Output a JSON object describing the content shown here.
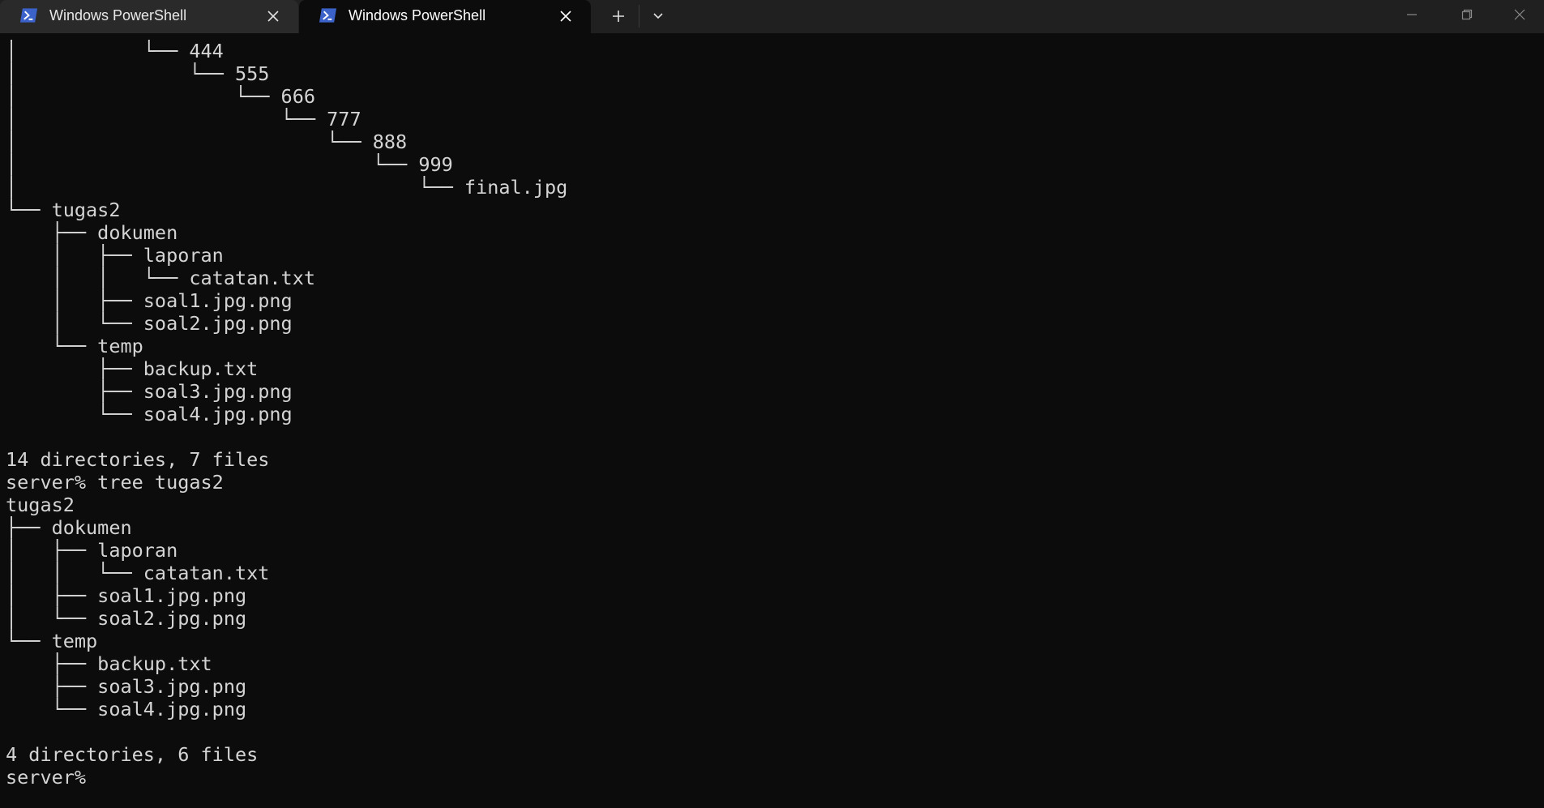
{
  "tabs": [
    {
      "label": "Windows PowerShell",
      "active": false
    },
    {
      "label": "Windows PowerShell",
      "active": true
    }
  ],
  "titlebar": {
    "new_tab_icon": "plus-icon",
    "dropdown_icon": "chevron-down-icon",
    "window_controls": [
      "minimize-icon",
      "maximize-icon",
      "close-icon"
    ]
  },
  "colors": {
    "terminal_bg": "#0c0c0c",
    "terminal_fg": "#d4d4d4",
    "titlebar_bg": "#202020",
    "powershell_icon": "#3a62c9"
  },
  "terminal": {
    "lines": [
      "│           └── 444",
      "│               └── 555",
      "│                   └── 666",
      "│                       └── 777",
      "│                           └── 888",
      "│                               └── 999",
      "│                                   └── final.jpg",
      "└── tugas2",
      "    ├── dokumen",
      "    │   ├── laporan",
      "    │   │   └── catatan.txt",
      "    │   ├── soal1.jpg.png",
      "    │   └── soal2.jpg.png",
      "    └── temp",
      "        ├── backup.txt",
      "        ├── soal3.jpg.png",
      "        └── soal4.jpg.png",
      "",
      "14 directories, 7 files",
      "server% tree tugas2",
      "tugas2",
      "├── dokumen",
      "│   ├── laporan",
      "│   │   └── catatan.txt",
      "│   ├── soal1.jpg.png",
      "│   └── soal2.jpg.png",
      "└── temp",
      "    ├── backup.txt",
      "    ├── soal3.jpg.png",
      "    └── soal4.jpg.png",
      "",
      "4 directories, 6 files",
      "server%"
    ]
  }
}
